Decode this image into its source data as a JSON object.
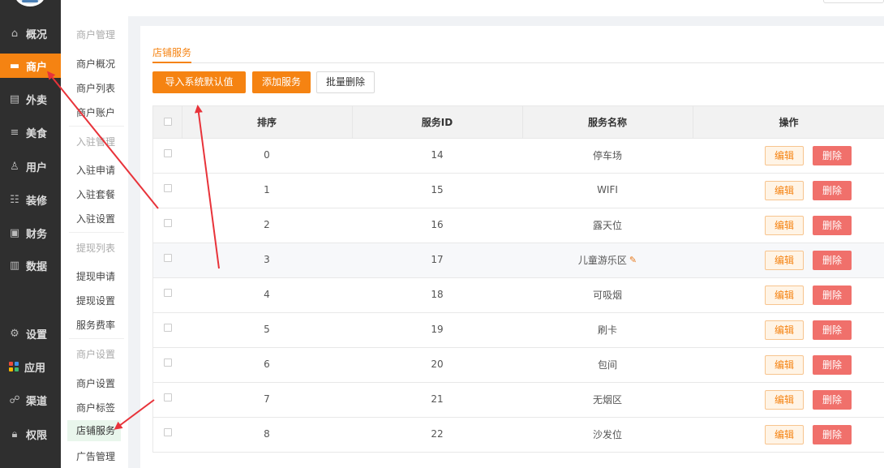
{
  "nav": {
    "items": [
      {
        "label": "概况",
        "icon": "home-icon",
        "active": false
      },
      {
        "label": "商户",
        "icon": "store-icon",
        "active": true
      },
      {
        "label": "外卖",
        "icon": "takeout-icon",
        "active": false
      },
      {
        "label": "美食",
        "icon": "menu-icon",
        "active": false
      },
      {
        "label": "用户",
        "icon": "user-icon",
        "active": false
      },
      {
        "label": "装修",
        "icon": "decorate-icon",
        "active": false
      },
      {
        "label": "财务",
        "icon": "finance-icon",
        "active": false
      },
      {
        "label": "数据",
        "icon": "chart-icon",
        "active": false
      },
      {
        "label": "设置",
        "icon": "gear-icon",
        "active": false
      },
      {
        "label": "应用",
        "icon": "apps-icon",
        "active": false
      },
      {
        "label": "渠道",
        "icon": "channel-icon",
        "active": false
      },
      {
        "label": "权限",
        "icon": "lock-icon",
        "active": false
      }
    ],
    "accent_color": "#f58312"
  },
  "subnav": {
    "groups": [
      {
        "title": "商户管理",
        "items": [
          "商户概况",
          "商户列表",
          "商户账户"
        ]
      },
      {
        "title": "入驻管理",
        "items": [
          "入驻申请",
          "入驻套餐",
          "入驻设置"
        ]
      },
      {
        "title": "提现列表",
        "items": [
          "提现申请",
          "提现设置",
          "服务费率"
        ]
      },
      {
        "title": "商户设置",
        "items": [
          "商户设置",
          "商户标签",
          "店铺服务",
          "广告管理"
        ]
      }
    ],
    "active_item": "店铺服务"
  },
  "main": {
    "tab_label": "店铺服务",
    "buttons": {
      "import_default": "导入系统默认值",
      "add_service": "添加服务",
      "batch_delete": "批量删除"
    },
    "table": {
      "columns": [
        "排序",
        "服务ID",
        "服务名称",
        "操作"
      ],
      "rows": [
        {
          "sort": "0",
          "id": "14",
          "name": "停车场"
        },
        {
          "sort": "1",
          "id": "15",
          "name": "WIFI"
        },
        {
          "sort": "2",
          "id": "16",
          "name": "露天位"
        },
        {
          "sort": "3",
          "id": "17",
          "name": "儿童游乐区"
        },
        {
          "sort": "4",
          "id": "18",
          "name": "可吸烟"
        },
        {
          "sort": "5",
          "id": "19",
          "name": "刷卡"
        },
        {
          "sort": "6",
          "id": "20",
          "name": "包间"
        },
        {
          "sort": "7",
          "id": "21",
          "name": "无烟区"
        },
        {
          "sort": "8",
          "id": "22",
          "name": "沙发位"
        }
      ],
      "edit_label": "编辑",
      "delete_label": "删除"
    }
  },
  "colors": {
    "primary": "#f58312",
    "danger": "#f0706b",
    "sidebar_bg": "#2f2f2f",
    "annotation_arrow": "#e8333a"
  }
}
